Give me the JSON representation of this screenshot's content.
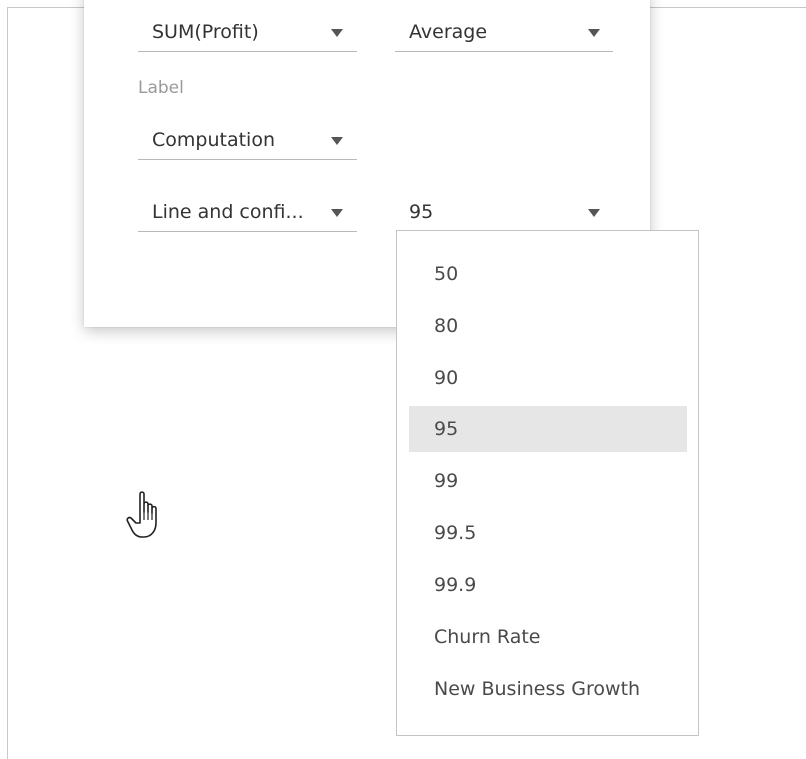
{
  "panel": {
    "measure_dropdown": {
      "value": "SUM(Profit)",
      "icon": "caret-down-icon"
    },
    "aggregation_dropdown": {
      "value": "Average",
      "icon": "caret-down-icon"
    },
    "label_heading": "Label",
    "label_dropdown": {
      "value": "Computation",
      "icon": "caret-down-icon"
    },
    "line_dropdown": {
      "value": "Line and confi...",
      "icon": "caret-down-icon"
    },
    "confidence_dropdown": {
      "value": "95",
      "icon": "caret-down-icon"
    }
  },
  "confidence_menu": {
    "items": [
      {
        "label": "50",
        "selected": false
      },
      {
        "label": "80",
        "selected": false
      },
      {
        "label": "90",
        "selected": false
      },
      {
        "label": "95",
        "selected": true
      },
      {
        "label": "99",
        "selected": false
      },
      {
        "label": "99.5",
        "selected": false
      },
      {
        "label": "99.9",
        "selected": false
      },
      {
        "label": "Churn Rate",
        "selected": false
      },
      {
        "label": "New Business Growth",
        "selected": false
      }
    ]
  },
  "colors": {
    "selected_item_bg": "#e6e6e6",
    "text": "#333333",
    "muted_label": "#9a9a9a",
    "divider": "#b9b9b9"
  },
  "cursor": {
    "icon": "hand-pointer-icon"
  }
}
